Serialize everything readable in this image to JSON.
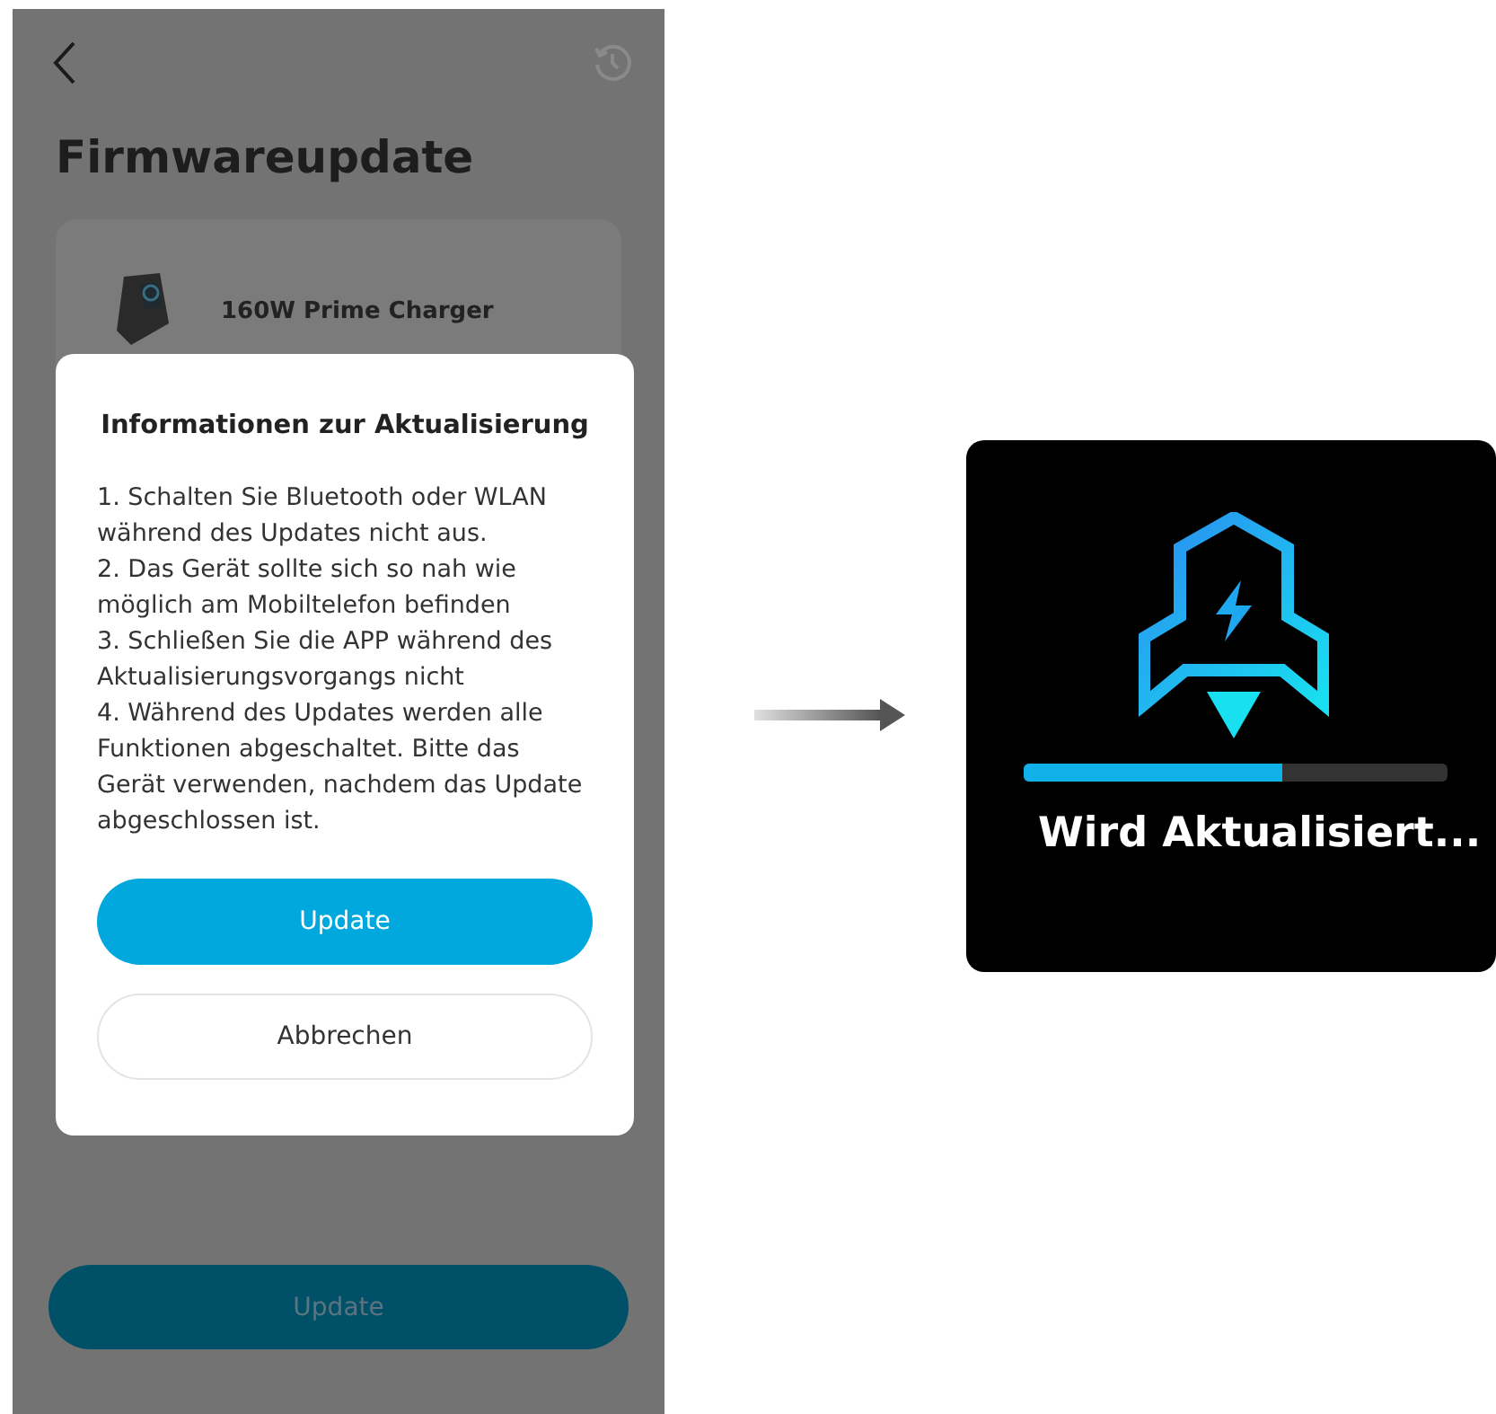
{
  "app_screen": {
    "title": "Firmwareupdate",
    "device": {
      "name": "160W Prime Charger"
    },
    "update_button": {
      "label": "Update",
      "disabled": true
    }
  },
  "dialog": {
    "title": "Informationen zur Aktualisierung",
    "items": [
      "1. Schalten Sie Bluetooth oder WLAN während des Updates nicht aus.",
      "2. Das Gerät sollte sich so nah wie möglich am Mobiltelefon befinden",
      "3. Schließen Sie die APP während des Aktualisierungsvorgangs nicht",
      "4. Während des Updates werden alle Funktionen abgeschaltet. Bitte das Gerät verwenden, nachdem das Update abgeschlossen ist."
    ],
    "buttons": [
      {
        "label": "Update",
        "kind": "primary"
      },
      {
        "label": "Abbrechen",
        "kind": "secondary"
      }
    ]
  },
  "device_display": {
    "progress": {
      "level": 0.61
    },
    "status": "Wird Aktualisiert..."
  }
}
